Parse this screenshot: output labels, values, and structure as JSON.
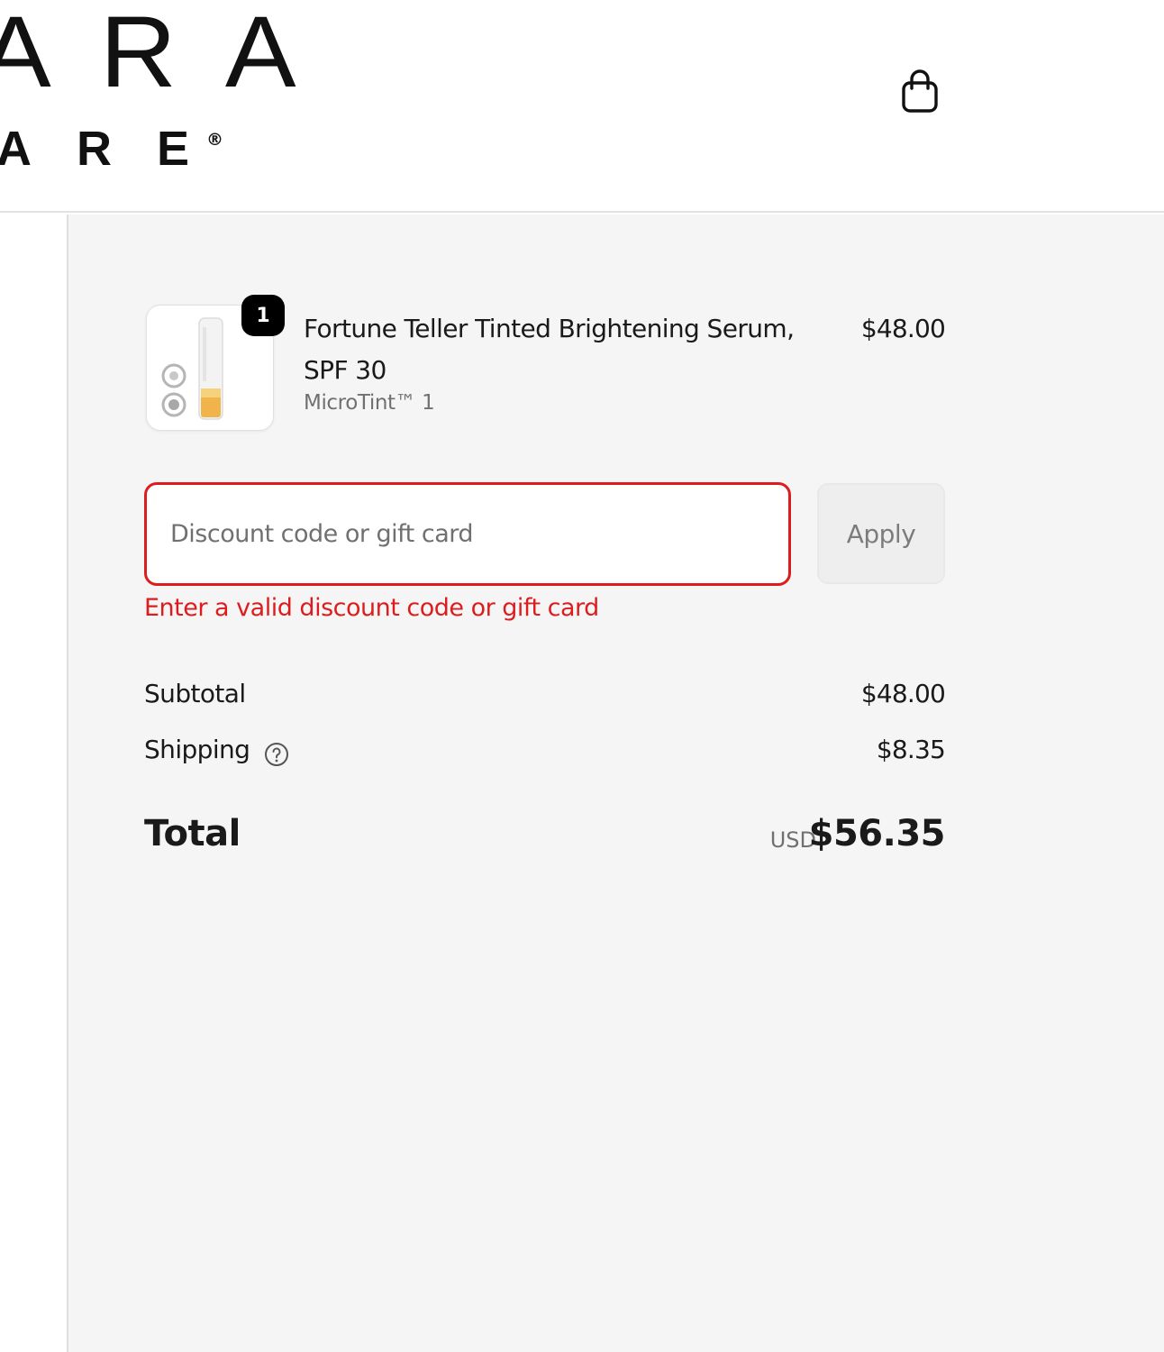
{
  "header": {
    "logo_line1": "ARA",
    "logo_line2": "ARE",
    "logo_mark": "®",
    "cart_icon": "shopping-bag-icon"
  },
  "order_summary": {
    "item": {
      "quantity": "1",
      "name": "Fortune Teller Tinted Brightening Serum, SPF 30",
      "variant": "MicroTint™ 1",
      "price": "$48.00",
      "image": "product-thumbnail"
    },
    "discount": {
      "placeholder": "Discount code or gift card",
      "value": "",
      "apply_label": "Apply",
      "error": "Enter a valid discount code or gift card"
    },
    "subtotal": {
      "label": "Subtotal",
      "value": "$48.00"
    },
    "shipping": {
      "label": "Shipping",
      "value": "$8.35",
      "help_icon": "question-circle-icon"
    },
    "total": {
      "label": "Total",
      "currency": "USD",
      "value": "$56.35"
    }
  },
  "colors": {
    "error": "#dd1d1d",
    "summary_bg": "#f5f5f5",
    "badge_bg": "#000000",
    "text": "#1a1a1a",
    "muted": "#707070"
  }
}
